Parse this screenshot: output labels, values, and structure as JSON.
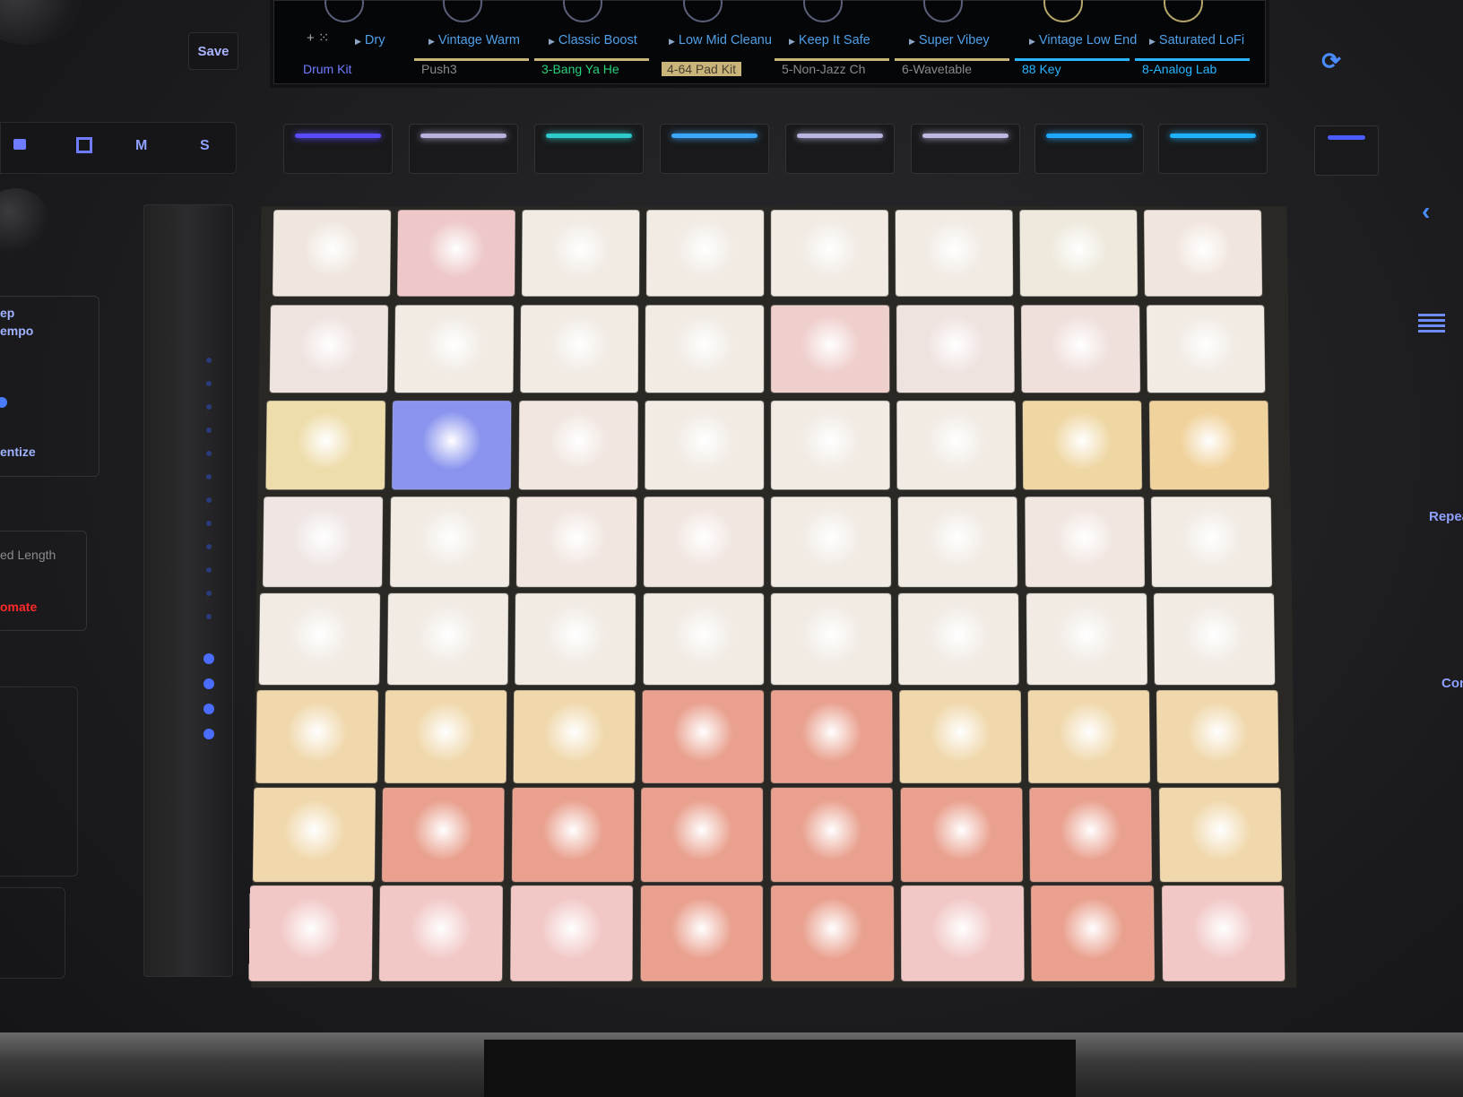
{
  "screen": {
    "presets": [
      {
        "label": "Dry"
      },
      {
        "label": "Vintage Warm"
      },
      {
        "label": "Classic Boost"
      },
      {
        "label": "Low Mid Cleanu"
      },
      {
        "label": "Keep It Safe"
      },
      {
        "label": "Super Vibey"
      },
      {
        "label": "Vintage Low End"
      },
      {
        "label": "Saturated LoFi"
      }
    ],
    "tracks": [
      {
        "label": "Drum Kit",
        "color": "#6f7cff"
      },
      {
        "label": "Push3",
        "color": "#8a8a8a"
      },
      {
        "label": "3-Bang Ya He",
        "color": "#27d07a"
      },
      {
        "label": "4-64 Pad Kit",
        "color": "#c9b47a"
      },
      {
        "label": "5-Non-Jazz Ch",
        "color": "#8a8a8a"
      },
      {
        "label": "6-Wavetable",
        "color": "#8a8a8a"
      },
      {
        "label": "88 Key",
        "color": "#29b6ff"
      },
      {
        "label": "8-Analog Lab",
        "color": "#29b6ff"
      }
    ]
  },
  "controls": {
    "save": "Save",
    "mute": "M",
    "solo": "S",
    "left_labels": [
      "ep",
      "empo",
      "entize",
      "ed Length",
      "omate"
    ],
    "right_labels": [
      "Repea",
      "Con"
    ]
  },
  "upper_leds": [
    "#5a4bff",
    "#b9b2dd",
    "#2ec9c9",
    "#3ba7ff",
    "#b8b6e0",
    "#c0b8e0",
    "#1fa8ff",
    "#1fb2ff"
  ],
  "pads": {
    "rows": [
      [
        "#efe6de",
        "#eec8c8",
        "#f1ebe4",
        "#f1ebe4",
        "#f1ebe4",
        "#f1ebe4",
        "#eee9dc",
        "#f1e6de"
      ],
      [
        "#efe3e0",
        "#f1ebe4",
        "#f1ebe4",
        "#f1ebe4",
        "#efcfcc",
        "#efe3e0",
        "#efe0dc",
        "#f1ebe4"
      ],
      [
        "#eedcaa",
        "#8a94ee",
        "#f1e6e0",
        "#f1ebe4",
        "#f1ebe4",
        "#f1ebe4",
        "#efd7a4",
        "#f0d29c"
      ],
      [
        "#efe6e4",
        "#f1ebe4",
        "#f1e6e0",
        "#f1e6e0",
        "#f1ebe4",
        "#f1ebe4",
        "#f1e6e0",
        "#f1ebe4"
      ],
      [
        "#f1ebe4",
        "#f1ebe4",
        "#f1ebe4",
        "#f1ebe4",
        "#f1ebe4",
        "#f1ebe4",
        "#f1ebe4",
        "#f1ebe4"
      ],
      [
        "#f0d8ac",
        "#f0d8ac",
        "#f0d8ac",
        "#e9a08e",
        "#e9a08e",
        "#f0d8ac",
        "#f0d8ac",
        "#f0d8ac"
      ],
      [
        "#f0d8ac",
        "#e9a08e",
        "#e9a08e",
        "#e9a08e",
        "#e9a08e",
        "#e9a08e",
        "#e9a08e",
        "#f0d8ac"
      ],
      [
        "#f1c8c6",
        "#f1c8c6",
        "#f1c8c6",
        "#e9a08e",
        "#e9a08e",
        "#f1c8c6",
        "#e9a08e",
        "#f1c8c6"
      ]
    ]
  }
}
